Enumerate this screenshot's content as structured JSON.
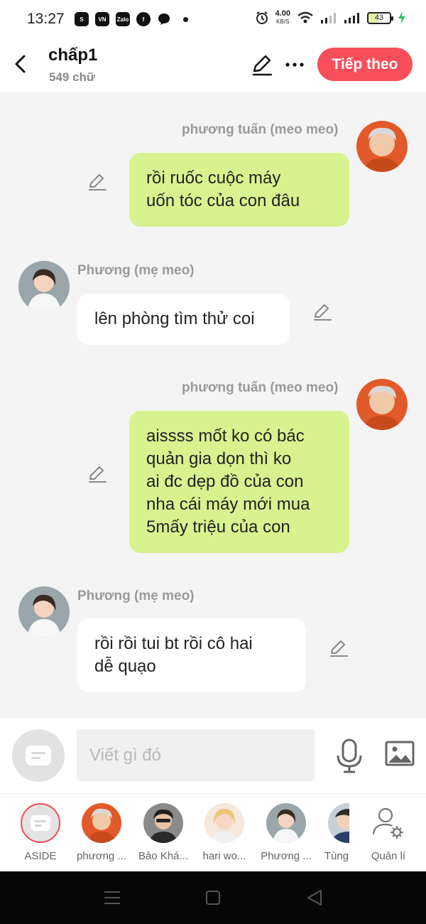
{
  "status_bar": {
    "time": "13:27",
    "app_icons": [
      "S",
      "VN",
      "Zalo",
      "f"
    ],
    "net_speed_value": "4.00",
    "net_speed_unit": "KB/S",
    "battery": "43"
  },
  "header": {
    "title": "chấp1",
    "word_count": "549 chữ",
    "next_button": "Tiếp theo"
  },
  "messages": [
    {
      "side": "right",
      "sender": "phương tuấn (meo meo)",
      "text": "rồi ruốc cuộc máy\nuốn tóc của con đâu"
    },
    {
      "side": "left",
      "sender": "Phương (mẹ meo)",
      "text": "lên phòng tìm thử coi"
    },
    {
      "side": "right",
      "sender": "phương tuấn (meo meo)",
      "text": "aissss mốt ko có bác\nquản gia dọn thì ko\nai đc dẹp đồ của con\nnha cái máy mới mua\n5mấy triệu của con"
    },
    {
      "side": "left",
      "sender": "Phương (mẹ meo)",
      "text": "rồi rồi tui bt rồi cô hai\ndễ quạo"
    }
  ],
  "composer": {
    "placeholder": "Viết gì đó"
  },
  "characters": [
    {
      "label": "ASIDE"
    },
    {
      "label": "phương ..."
    },
    {
      "label": "Bảo Khá..."
    },
    {
      "label": "hari wo..."
    },
    {
      "label": "Phương ..."
    },
    {
      "label": "Tùng"
    },
    {
      "label": "Quản lí"
    }
  ],
  "colors": {
    "accent": "#f74f5b",
    "bubble_right": "#d7f38f",
    "bubble_left": "#ffffff",
    "chat_bg": "#f4f4f4"
  }
}
